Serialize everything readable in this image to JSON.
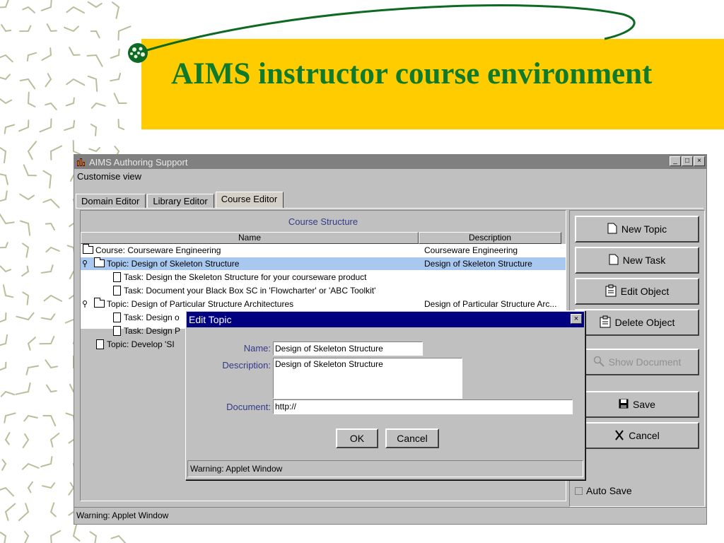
{
  "slide": {
    "title": "AIMS instructor course environment"
  },
  "window": {
    "title": "AIMS Authoring Support",
    "menu": "Customise view",
    "controls": [
      "_",
      "□",
      "×"
    ],
    "tabs": [
      {
        "label": "Domain Editor",
        "active": false
      },
      {
        "label": "Library Editor",
        "active": false
      },
      {
        "label": "Course Editor",
        "active": true
      }
    ],
    "status": "Warning: Applet Window"
  },
  "course_structure": {
    "title": "Course Structure",
    "columns": [
      "Name",
      "Description"
    ],
    "rows": [
      {
        "icon": "folder-icon",
        "name": "Course: Courseware Engineering",
        "description": "Courseware Engineering",
        "indent": 0,
        "pin": false,
        "selected": false
      },
      {
        "icon": "folder-icon",
        "name": "Topic: Design of Skeleton Structure",
        "description": "Design of Skeleton Structure",
        "indent": 1,
        "pin": true,
        "selected": true
      },
      {
        "icon": "document-icon",
        "name": "Task: Design the Skeleton Structure for your courseware product",
        "description": "",
        "indent": 2,
        "pin": false,
        "selected": false
      },
      {
        "icon": "document-icon",
        "name": "Task: Document your Black Box SC in 'Flowcharter' or 'ABC Toolkit'",
        "description": "",
        "indent": 2,
        "pin": false,
        "selected": false
      },
      {
        "icon": "folder-icon",
        "name": "Topic: Design of Particular Structure Architectures",
        "description": "Design of Particular Structure Arc...",
        "indent": 1,
        "pin": true,
        "selected": false
      },
      {
        "icon": "document-icon",
        "name": "Task: Design o",
        "description": "",
        "indent": 2,
        "pin": false,
        "selected": false
      },
      {
        "icon": "document-icon",
        "name": "Task: Design P",
        "description": "",
        "indent": 2,
        "pin": false,
        "selected": false
      },
      {
        "icon": "document-icon",
        "name": "Topic: Develop 'SI",
        "description": "",
        "indent": 1,
        "pin": false,
        "selected": false
      }
    ]
  },
  "actions": {
    "new_topic": "New Topic",
    "new_task": "New Task",
    "edit_object": "Edit Object",
    "delete_object": "Delete Object",
    "show_document": "Show Document",
    "save": "Save",
    "cancel": "Cancel",
    "auto_save": "Auto Save",
    "auto_save_checked": false
  },
  "dialog": {
    "title": "Edit Topic",
    "close": "×",
    "name_label": "Name:",
    "name_value": "Design of Skeleton Structure",
    "description_label": "Description:",
    "description_value": "Design of Skeleton Structure",
    "document_label": "Document:",
    "document_value": "http://",
    "ok": "OK",
    "cancel": "Cancel",
    "status": "Warning: Applet Window"
  },
  "colors": {
    "title_green": "#0e7a2a",
    "band_yellow": "#ffcc00",
    "dialog_title_bar": "#000080",
    "selection": "#a9c8ef",
    "swoosh": "#0e6a22"
  }
}
